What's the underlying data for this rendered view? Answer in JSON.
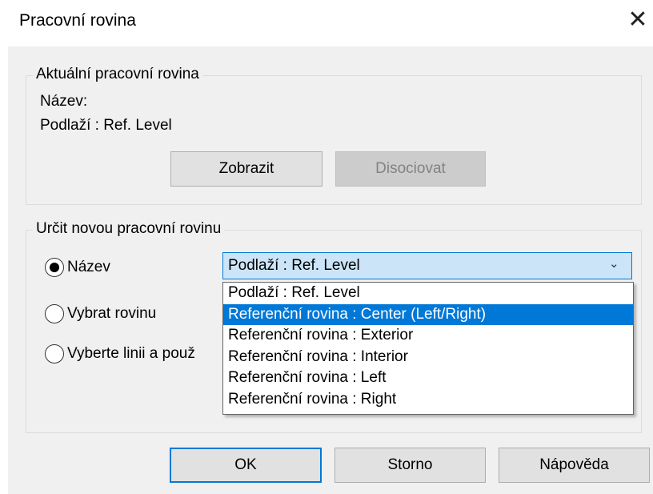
{
  "window": {
    "title": "Pracovní rovina",
    "close_icon": "close-icon"
  },
  "current_plane": {
    "legend": "Aktuální pracovní rovina",
    "name_label": "Název:",
    "level_label": "Podlaží : Ref. Level",
    "show_button": "Zobrazit",
    "dissociate_button": "Disociovat"
  },
  "new_plane": {
    "legend": "Určit novou pracovní rovinu",
    "options": [
      {
        "label": "Název",
        "checked": true
      },
      {
        "label": "Vybrat rovinu",
        "checked": false
      },
      {
        "label": "Vyberte linii a použ",
        "checked": false
      }
    ],
    "combo": {
      "value": "Podlaží : Ref. Level",
      "items": [
        {
          "label": "Podlaží : Ref. Level",
          "selected": false
        },
        {
          "label": "Referenční rovina : Center (Left/Right)",
          "selected": true
        },
        {
          "label": "Referenční rovina : Exterior",
          "selected": false
        },
        {
          "label": "Referenční rovina : Interior",
          "selected": false
        },
        {
          "label": "Referenční rovina : Left",
          "selected": false
        },
        {
          "label": "Referenční rovina : Right",
          "selected": false
        }
      ]
    }
  },
  "footer": {
    "ok": "OK",
    "cancel": "Storno",
    "help": "Nápověda"
  },
  "colors": {
    "accent": "#0078d7",
    "dialog_bg": "#f0f0f0",
    "combo_bg": "#cce4f7"
  }
}
